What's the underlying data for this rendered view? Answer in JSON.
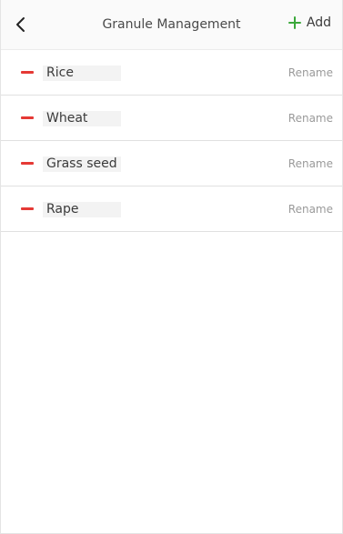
{
  "header": {
    "title": "Granule Management",
    "add_label": "Add",
    "back_icon": "chevron-left-icon",
    "add_icon": "plus-icon",
    "accent_color": "#3aa83a"
  },
  "granules": [
    {
      "name": "Rice",
      "action": "Rename"
    },
    {
      "name": "Wheat",
      "action": "Rename"
    },
    {
      "name": "Grass seed",
      "action": "Rename"
    },
    {
      "name": "Rape",
      "action": "Rename"
    }
  ],
  "colors": {
    "remove": "#e53935",
    "rename_text": "#9a9a9a"
  }
}
